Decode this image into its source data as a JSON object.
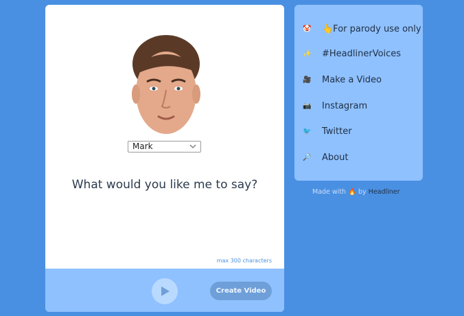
{
  "main": {
    "voice_select": {
      "value": "Mark"
    },
    "prompt": "What would you like me to say?",
    "max_chars": "max 300 characters",
    "create_label": "Create Video"
  },
  "sidebar": {
    "items": [
      {
        "label": "👆For parody use only",
        "icon": "🤡"
      },
      {
        "label": "#HeadlinerVoices",
        "icon": "✨"
      },
      {
        "label": "Make a Video",
        "icon": "🎥"
      },
      {
        "label": "Instagram",
        "icon": "📷"
      },
      {
        "label": "Twitter",
        "icon": "🐦"
      },
      {
        "label": "About",
        "icon": "🔎"
      }
    ]
  },
  "made_with": {
    "prefix": "Made with",
    "by": "by",
    "brand": "Headliner",
    "icon": "🔥"
  },
  "colors": {
    "background": "#4a90e2",
    "panel": "#8fc1ff",
    "button": "#6f9fd8"
  }
}
